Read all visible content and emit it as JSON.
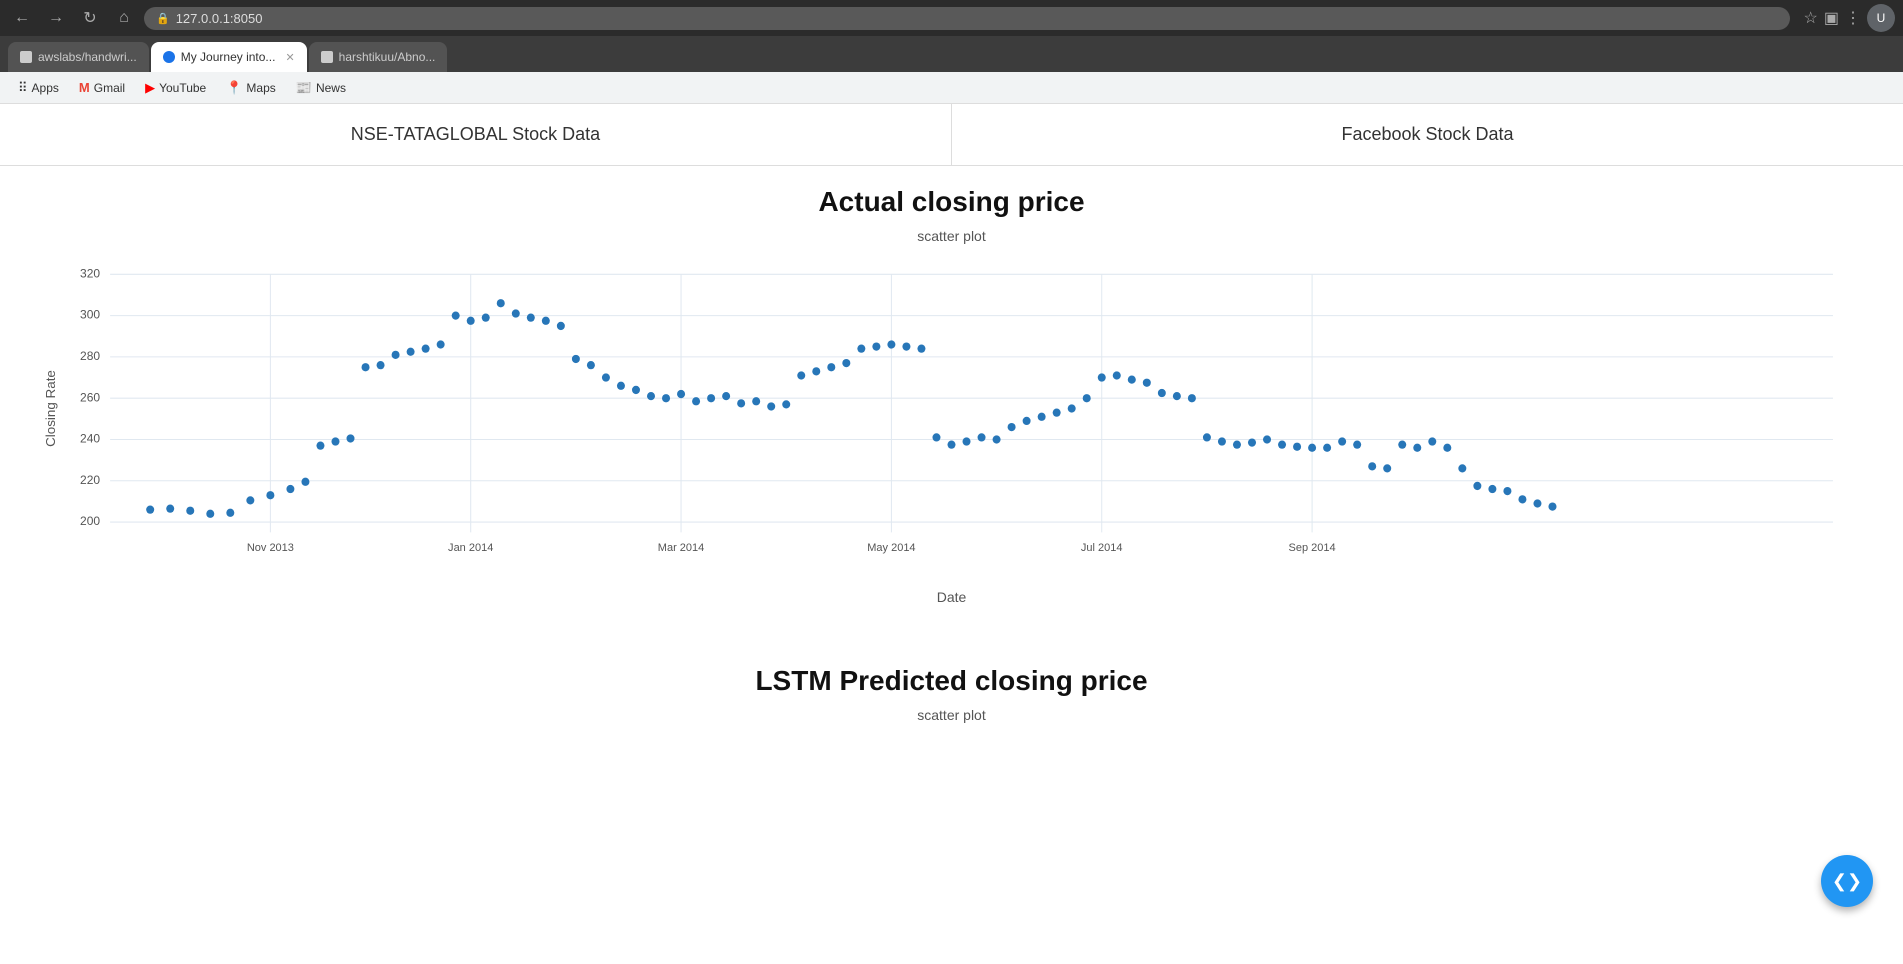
{
  "browser": {
    "url": "127.0.0.1:8050",
    "tabs": [
      {
        "id": "awslabs",
        "label": "awslabs/handwri...",
        "favicon_type": "default",
        "active": false
      },
      {
        "id": "myjourney",
        "label": "My Journey into...",
        "favicon_type": "medium",
        "active": true
      },
      {
        "id": "harshtikuu",
        "label": "harshtikuu/Abno...",
        "favicon_type": "default",
        "active": false
      }
    ],
    "bookmarks": [
      {
        "id": "apps",
        "label": "Apps",
        "favicon": "apps"
      },
      {
        "id": "gmail",
        "label": "Gmail",
        "favicon": "gmail"
      },
      {
        "id": "youtube",
        "label": "YouTube",
        "favicon": "youtube"
      },
      {
        "id": "maps",
        "label": "Maps",
        "favicon": "maps"
      },
      {
        "id": "news",
        "label": "News",
        "favicon": "news"
      }
    ]
  },
  "page": {
    "nav": {
      "items": [
        {
          "id": "tata",
          "label": "NSE-TATAGLOBAL Stock Data",
          "active": true
        },
        {
          "id": "facebook",
          "label": "Facebook Stock Data",
          "active": false
        }
      ]
    },
    "actual_section": {
      "title": "Actual closing price",
      "subtitle": "scatter plot",
      "x_axis_label": "Date",
      "y_axis_label": "Closing Rate",
      "x_labels": [
        "Nov 2013",
        "Jan 2014",
        "Mar 2014",
        "May 2014",
        "Jul 2014",
        "Sep 2014"
      ],
      "y_labels": [
        "200",
        "220",
        "240",
        "260",
        "280",
        "300",
        "320"
      ],
      "y_min": 200,
      "y_max": 330
    },
    "lstm_section": {
      "title": "LSTM Predicted closing price",
      "subtitle": "scatter plot"
    },
    "nav_button": {
      "prev_symbol": "❮",
      "next_symbol": "❯"
    }
  }
}
